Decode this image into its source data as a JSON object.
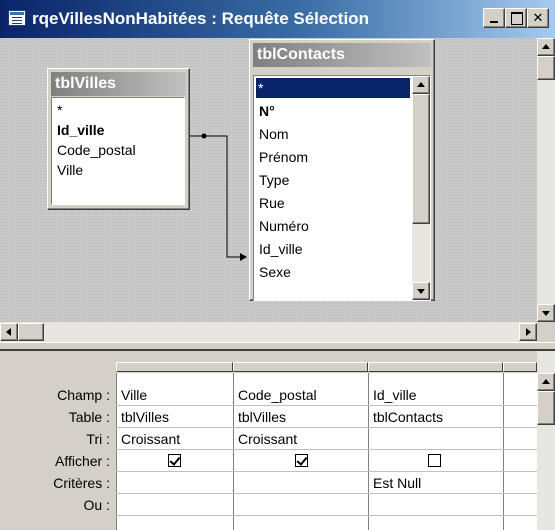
{
  "window": {
    "title": "rqeVillesNonHabitées : Requête Sélection"
  },
  "tables": {
    "villes": {
      "title": "tblVilles",
      "fields": [
        "*",
        "Id_ville",
        "Code_postal",
        "Ville"
      ]
    },
    "contacts": {
      "title": "tblContacts",
      "fields": [
        "*",
        "N°",
        "Nom",
        "Prénom",
        "Type",
        "Rue",
        "Numéro",
        "Id_ville",
        "Sexe"
      ]
    }
  },
  "grid": {
    "row_labels": [
      "Champ :",
      "Table :",
      "Tri :",
      "Afficher :",
      "Critères :",
      "Ou :"
    ],
    "columns": [
      {
        "champ": "Ville",
        "table": "tblVilles",
        "tri": "Croissant",
        "afficher": true,
        "criteres": "",
        "ou": ""
      },
      {
        "champ": "Code_postal",
        "table": "tblVilles",
        "tri": "Croissant",
        "afficher": true,
        "criteres": "",
        "ou": ""
      },
      {
        "champ": "Id_ville",
        "table": "tblContacts",
        "tri": "",
        "afficher": false,
        "criteres": "Est Null",
        "ou": ""
      }
    ]
  },
  "colors": {
    "title_active": "#0a246a",
    "title_inactive": "#808080",
    "face": "#d4d0c8"
  }
}
